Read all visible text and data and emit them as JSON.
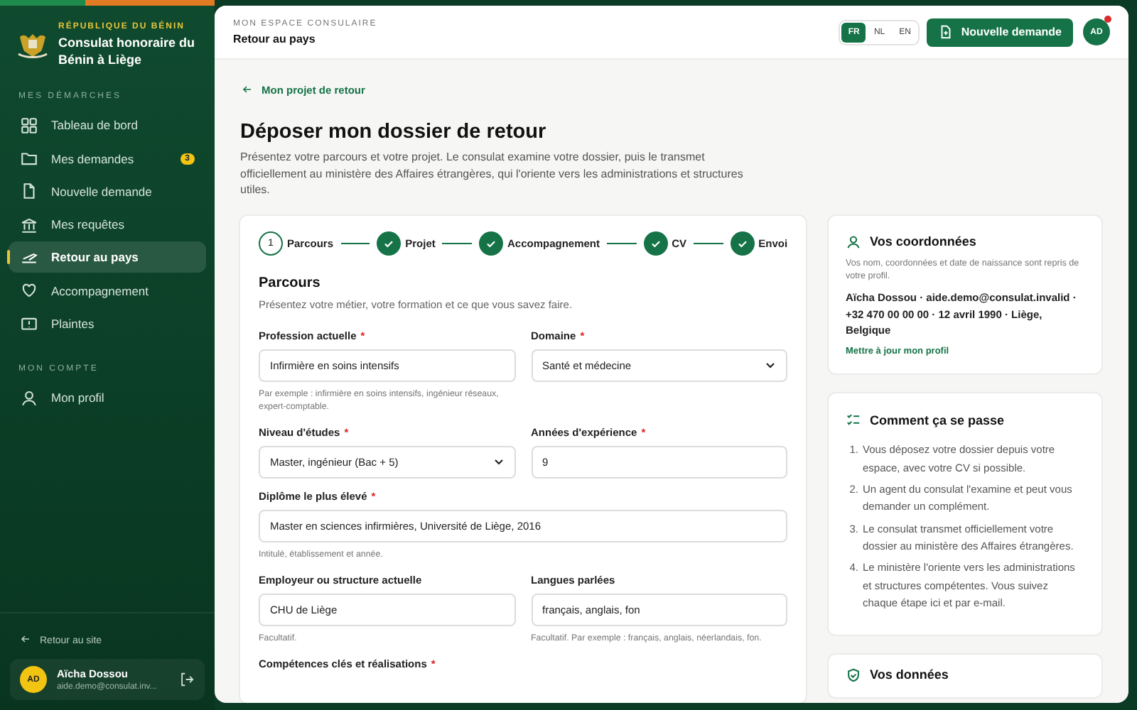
{
  "sidebar": {
    "eyebrow": "RÉPUBLIQUE DU BÉNIN",
    "org": "Consulat honoraire du Bénin à Liège",
    "sections": [
      {
        "heading": "MES DÉMARCHES",
        "items": [
          {
            "label": "Tableau de bord",
            "selected": false
          },
          {
            "label": "Mes demandes",
            "selected": false,
            "badge": "3"
          },
          {
            "label": "Nouvelle demande",
            "selected": false
          },
          {
            "label": "Mes requêtes",
            "selected": false
          },
          {
            "label": "Retour au pays",
            "selected": true
          },
          {
            "label": "Accompagnement",
            "selected": false
          },
          {
            "label": "Plaintes",
            "selected": false
          }
        ]
      },
      {
        "heading": "MON COMPTE",
        "items": [
          {
            "label": "Mon profil",
            "selected": false
          }
        ]
      }
    ],
    "back_link": "Retour au site",
    "user": {
      "initials": "AD",
      "name": "Aïcha Dossou",
      "email": "aide.demo@consulat.inv..."
    }
  },
  "header": {
    "eyebrow": "MON ESPACE CONSULAIRE",
    "title": "Retour au pays",
    "languages": [
      {
        "label": "FR",
        "selected": true
      },
      {
        "label": "NL",
        "selected": false
      },
      {
        "label": "EN",
        "selected": false
      }
    ],
    "new_request": "Nouvelle demande",
    "avatar": "AD",
    "notification": true
  },
  "page": {
    "back_link": "Mon projet de retour",
    "title": "Déposer mon dossier de retour",
    "intro": "Présentez votre parcours et votre projet. Le consulat examine votre dossier, puis le transmet officiellement au ministère des Affaires étrangères, qui l'oriente vers les administrations et structures utiles."
  },
  "stepper": [
    {
      "number": "1",
      "label": "Parcours",
      "done": false
    },
    {
      "label": "Projet",
      "done": true
    },
    {
      "label": "Accompagnement",
      "done": true
    },
    {
      "label": "CV",
      "done": true
    },
    {
      "label": "Envoi",
      "done": true
    }
  ],
  "form": {
    "title": "Parcours",
    "subtitle": "Présentez votre métier, votre formation et ce que vous savez faire.",
    "rows": [
      [
        {
          "kind": "input",
          "label": "Profession actuelle",
          "mark": "*",
          "value": "Infirmière en soins intensifs",
          "hint": "Par exemple : infirmière en soins intensifs, ingénieur réseaux, expert-comptable."
        },
        {
          "kind": "select",
          "label": "Domaine",
          "mark": "*",
          "value": "Santé et médecine"
        }
      ],
      [
        {
          "kind": "select",
          "label": "Niveau d'études",
          "mark": "*",
          "value": "Master, ingénieur (Bac + 5)"
        },
        {
          "kind": "input",
          "label": "Années d'expérience",
          "mark": "*",
          "value": "9"
        }
      ],
      [
        {
          "kind": "input",
          "label": "Diplôme le plus élevé",
          "mark": "*",
          "value": "Master en sciences infirmières, Université de Liège, 2016",
          "hint": "Intitulé, établissement et année."
        }
      ],
      [
        {
          "kind": "input",
          "label": "Employeur ou structure actuelle",
          "value": "CHU de Liège",
          "hint": "Facultatif."
        },
        {
          "kind": "input",
          "label": "Langues parlées",
          "value": "français, anglais, fon",
          "hint": "Facultatif. Par exemple : français, anglais, néerlandais, fon."
        }
      ],
      [
        {
          "kind": "label",
          "label": "Compétences clés et réalisations",
          "mark": "*"
        }
      ]
    ]
  },
  "aside": {
    "contact": {
      "title": "Vos coordonnées",
      "note": "Vos nom, coordonnées et date de naissance sont repris de votre profil.",
      "details": "Aïcha Dossou · aide.demo@consulat.invalid · +32 470 00 00 00 · 12 avril 1990 · Liège, Belgique",
      "link": "Mettre à jour mon profil"
    },
    "process": {
      "title": "Comment ça se passe",
      "steps": [
        {
          "number": "1.",
          "text": "Vous déposez votre dossier depuis votre espace, avec votre CV si possible."
        },
        {
          "number": "2.",
          "text": "Un agent du consulat l'examine et peut vous demander un complément."
        },
        {
          "number": "3.",
          "text": "Le consulat transmet officiellement votre dossier au ministère des Affaires étrangères."
        },
        {
          "number": "4.",
          "text": "Le ministère l'oriente vers les administrations et structures compétentes. Vous suivez chaque étape ici et par e-mail."
        }
      ]
    },
    "data_title": "Vos données"
  }
}
